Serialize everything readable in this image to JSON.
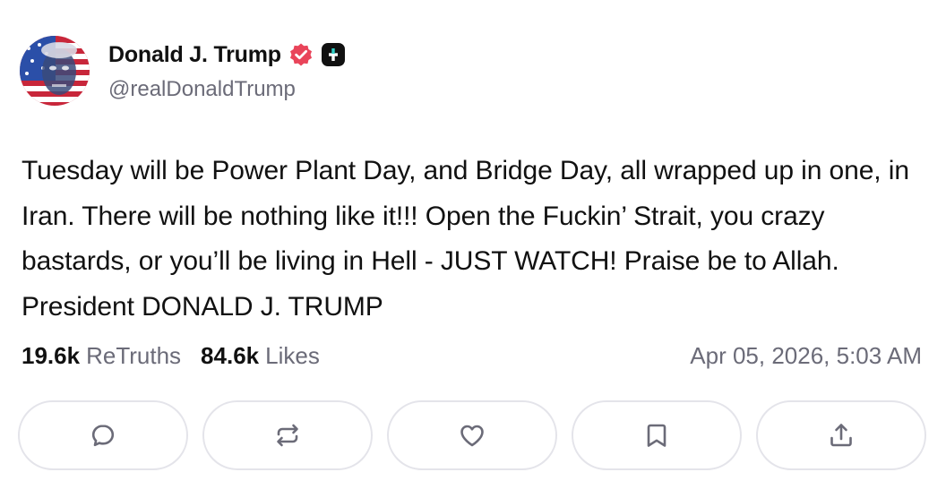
{
  "author": {
    "display_name": "Donald J. Trump",
    "handle": "@realDonaldTrump",
    "verified_badge_color": "#e9445a",
    "badge_icon": "verified-icon",
    "plus_badge_icon": "plus-badge-icon"
  },
  "post": {
    "text": "Tuesday will be Power Plant Day, and Bridge Day, all wrapped up in one, in Iran. There will be nothing like it!!! Open the Fuckin’ Strait, you crazy bastards, or you’ll be living in Hell - JUST WATCH! Praise be to Allah. President DONALD J. TRUMP",
    "timestamp": "Apr 05, 2026, 5:03 AM"
  },
  "stats": {
    "retruths_count": "19.6k",
    "retruths_label": "ReTruths",
    "likes_count": "84.6k",
    "likes_label": "Likes"
  },
  "actions": [
    {
      "name": "reply",
      "icon": "comment-icon"
    },
    {
      "name": "retruth",
      "icon": "repost-icon"
    },
    {
      "name": "like",
      "icon": "heart-icon"
    },
    {
      "name": "bookmark",
      "icon": "bookmark-icon"
    },
    {
      "name": "share",
      "icon": "share-icon"
    }
  ],
  "colors": {
    "text_primary": "#111111",
    "text_secondary": "#6b6b78",
    "border": "#e4e4ea",
    "icon": "#6b6b78"
  }
}
